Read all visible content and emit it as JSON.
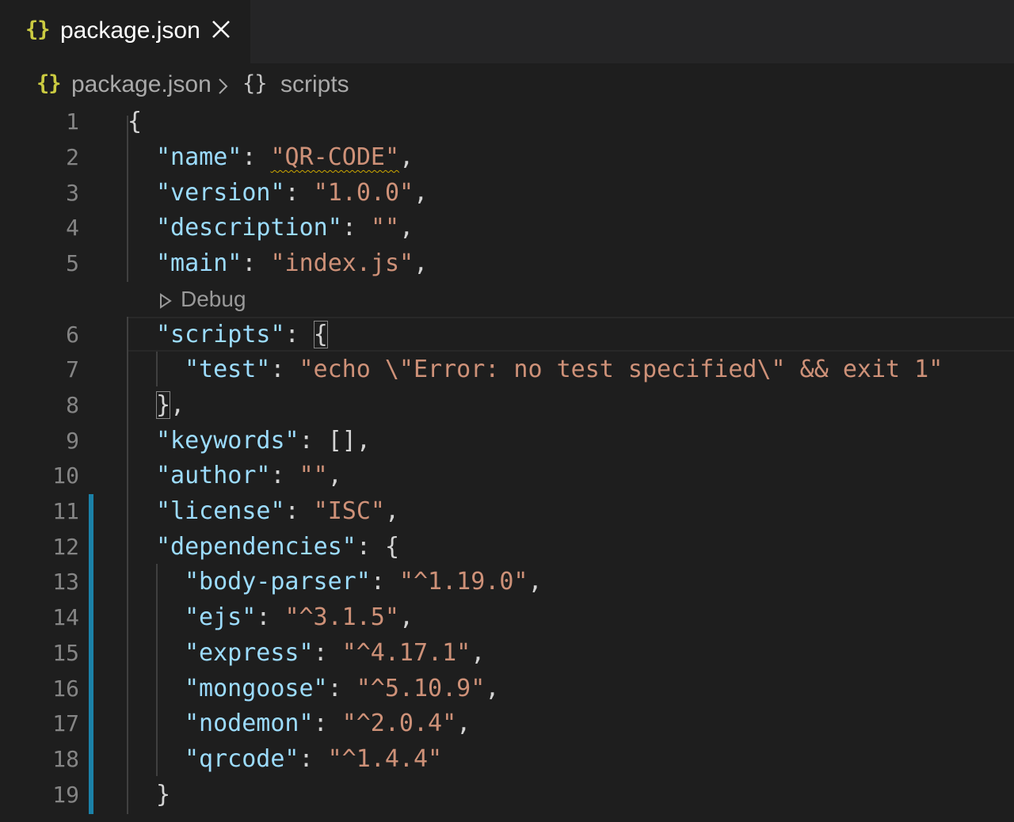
{
  "tab": {
    "icon": "json-braces-icon",
    "braces": "{}",
    "label": "package.json"
  },
  "breadcrumb": {
    "file_braces": "{}",
    "file": "package.json",
    "symbol_braces": "{}",
    "symbol": "scripts"
  },
  "codelens": {
    "label": "Debug"
  },
  "colors": {
    "key": "#9cdcfe",
    "string": "#ce9178",
    "punct": "#d4d4d4",
    "modified_bar": "#1b81a8",
    "json_icon": "#cbcb41"
  },
  "lines": [
    {
      "n": "1",
      "tokens": [
        {
          "t": "{",
          "c": "p"
        }
      ]
    },
    {
      "n": "2",
      "tokens": [
        {
          "t": "\"name\"",
          "c": "k"
        },
        {
          "t": ": ",
          "c": "p"
        },
        {
          "t": "\"QR-CODE\"",
          "c": "s",
          "squiggle": true
        },
        {
          "t": ",",
          "c": "p"
        }
      ]
    },
    {
      "n": "3",
      "tokens": [
        {
          "t": "\"version\"",
          "c": "k"
        },
        {
          "t": ": ",
          "c": "p"
        },
        {
          "t": "\"1.0.0\"",
          "c": "s"
        },
        {
          "t": ",",
          "c": "p"
        }
      ]
    },
    {
      "n": "4",
      "tokens": [
        {
          "t": "\"description\"",
          "c": "k"
        },
        {
          "t": ": ",
          "c": "p"
        },
        {
          "t": "\"\"",
          "c": "s"
        },
        {
          "t": ",",
          "c": "p"
        }
      ]
    },
    {
      "n": "5",
      "tokens": [
        {
          "t": "\"main\"",
          "c": "k"
        },
        {
          "t": ": ",
          "c": "p"
        },
        {
          "t": "\"index.js\"",
          "c": "s"
        },
        {
          "t": ",",
          "c": "p"
        }
      ]
    },
    {
      "n": "6",
      "tokens": [
        {
          "t": "\"scripts\"",
          "c": "k"
        },
        {
          "t": ": ",
          "c": "p"
        },
        {
          "t": "{",
          "c": "p",
          "bracket": true
        }
      ]
    },
    {
      "n": "7",
      "tokens": [
        {
          "t": "\"test\"",
          "c": "k"
        },
        {
          "t": ": ",
          "c": "p"
        },
        {
          "t": "\"echo \\\"Error: no test specified\\\" && exit 1\"",
          "c": "s"
        }
      ]
    },
    {
      "n": "8",
      "tokens": [
        {
          "t": "}",
          "c": "p",
          "bracket": true
        },
        {
          "t": ",",
          "c": "p"
        }
      ]
    },
    {
      "n": "9",
      "tokens": [
        {
          "t": "\"keywords\"",
          "c": "k"
        },
        {
          "t": ": [],",
          "c": "p"
        }
      ]
    },
    {
      "n": "10",
      "tokens": [
        {
          "t": "\"author\"",
          "c": "k"
        },
        {
          "t": ": ",
          "c": "p"
        },
        {
          "t": "\"\"",
          "c": "s"
        },
        {
          "t": ",",
          "c": "p"
        }
      ]
    },
    {
      "n": "11",
      "tokens": [
        {
          "t": "\"license\"",
          "c": "k"
        },
        {
          "t": ": ",
          "c": "p"
        },
        {
          "t": "\"ISC\"",
          "c": "s"
        },
        {
          "t": ",",
          "c": "p"
        }
      ]
    },
    {
      "n": "12",
      "tokens": [
        {
          "t": "\"dependencies\"",
          "c": "k"
        },
        {
          "t": ": {",
          "c": "p"
        }
      ]
    },
    {
      "n": "13",
      "tokens": [
        {
          "t": "\"body-parser\"",
          "c": "k"
        },
        {
          "t": ": ",
          "c": "p"
        },
        {
          "t": "\"^1.19.0\"",
          "c": "s"
        },
        {
          "t": ",",
          "c": "p"
        }
      ]
    },
    {
      "n": "14",
      "tokens": [
        {
          "t": "\"ejs\"",
          "c": "k"
        },
        {
          "t": ": ",
          "c": "p"
        },
        {
          "t": "\"^3.1.5\"",
          "c": "s"
        },
        {
          "t": ",",
          "c": "p"
        }
      ]
    },
    {
      "n": "15",
      "tokens": [
        {
          "t": "\"express\"",
          "c": "k"
        },
        {
          "t": ": ",
          "c": "p"
        },
        {
          "t": "\"^4.17.1\"",
          "c": "s"
        },
        {
          "t": ",",
          "c": "p"
        }
      ]
    },
    {
      "n": "16",
      "tokens": [
        {
          "t": "\"mongoose\"",
          "c": "k"
        },
        {
          "t": ": ",
          "c": "p"
        },
        {
          "t": "\"^5.10.9\"",
          "c": "s"
        },
        {
          "t": ",",
          "c": "p"
        }
      ]
    },
    {
      "n": "17",
      "tokens": [
        {
          "t": "\"nodemon\"",
          "c": "k"
        },
        {
          "t": ": ",
          "c": "p"
        },
        {
          "t": "\"^2.0.4\"",
          "c": "s"
        },
        {
          "t": ",",
          "c": "p"
        }
      ]
    },
    {
      "n": "18",
      "tokens": [
        {
          "t": "\"qrcode\"",
          "c": "k"
        },
        {
          "t": ": ",
          "c": "p"
        },
        {
          "t": "\"^1.4.4\"",
          "c": "s"
        }
      ]
    },
    {
      "n": "19",
      "tokens": [
        {
          "t": "}",
          "c": "p"
        }
      ]
    }
  ]
}
